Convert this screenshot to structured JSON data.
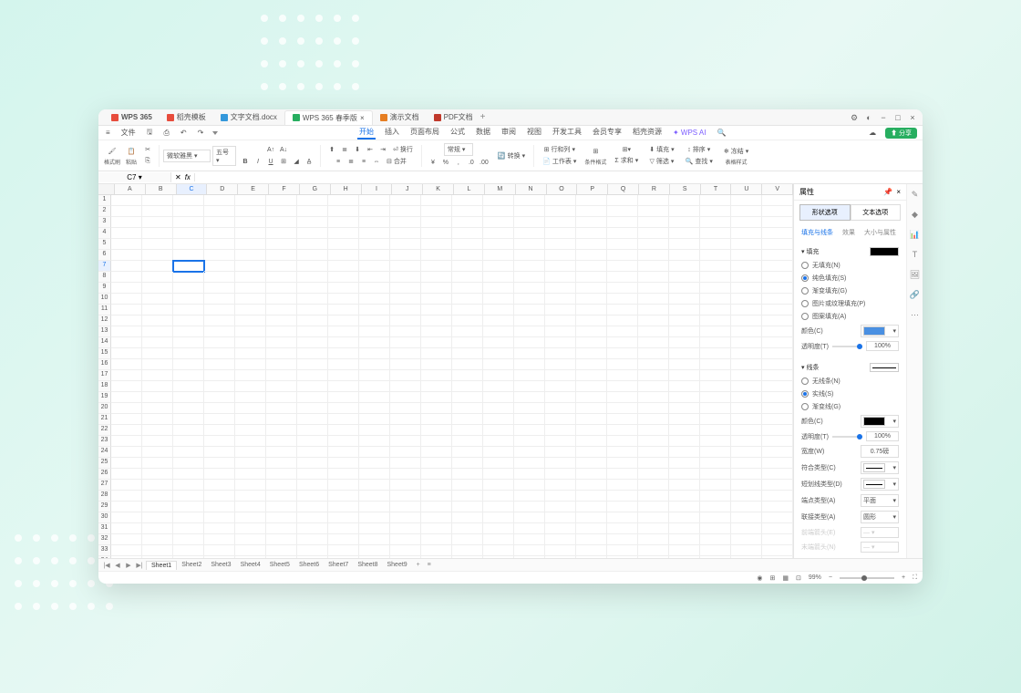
{
  "titlebar": {
    "logo": "WPS 365",
    "tabs": [
      {
        "label": "稻壳模板",
        "icon": "red"
      },
      {
        "label": "文字文档.docx",
        "icon": "blue"
      },
      {
        "label": "WPS 365 春季版",
        "icon": "green",
        "active": true
      },
      {
        "label": "演示文档",
        "icon": "orange"
      },
      {
        "label": "PDF文档",
        "icon": "pdf"
      }
    ]
  },
  "menubar": {
    "file": "文件",
    "items": [
      "开始",
      "插入",
      "页面布局",
      "公式",
      "数据",
      "审阅",
      "视图",
      "开发工具",
      "会员专享",
      "稻壳资源"
    ],
    "active_index": 0,
    "wps_ai": "WPS AI",
    "share": "分享"
  },
  "ribbon": {
    "format_brush": "格式刷",
    "paste": "粘贴",
    "font": "微软雅黑",
    "font_size": "五号",
    "number_format": "常规",
    "wrap_text": "换行",
    "convert": "转换",
    "merge": "合并",
    "row_col": "行和列",
    "worksheet": "工作表",
    "cond_fmt": "条件格式",
    "fill": "填充",
    "sort": "排序",
    "filter": "筛选",
    "freeze": "冻结",
    "find": "查找",
    "sum": "求和",
    "table_style": "表格样式"
  },
  "formula": {
    "cell_ref": "C7"
  },
  "columns": [
    "A",
    "B",
    "C",
    "D",
    "E",
    "F",
    "G",
    "H",
    "I",
    "J",
    "K",
    "L",
    "M",
    "N",
    "O",
    "P",
    "Q",
    "R",
    "S",
    "T",
    "U",
    "V"
  ],
  "row_count": 45,
  "selected_col": 2,
  "selected_row": 7,
  "sheets": [
    "Sheet1",
    "Sheet2",
    "Sheet3",
    "Sheet4",
    "Sheet5",
    "Sheet6",
    "Sheet7",
    "Sheet8",
    "Sheet9"
  ],
  "active_sheet": 0,
  "panel": {
    "title": "属性",
    "main_tabs": [
      "形状选项",
      "文本选项"
    ],
    "active_main_tab": 0,
    "sub_tabs": [
      "填充与线条",
      "效果",
      "大小与属性"
    ],
    "active_sub_tab": 0,
    "fill": {
      "header": "填充",
      "options": [
        "无填充(N)",
        "纯色填充(S)",
        "渐变填充(G)",
        "图片或纹理填充(P)",
        "图案填充(A)"
      ],
      "selected": 1,
      "color_label": "颜色(C)",
      "trans_label": "透明度(T)",
      "trans_value": "100%"
    },
    "line": {
      "header": "线条",
      "options": [
        "无线条(N)",
        "实线(S)",
        "渐变线(G)"
      ],
      "selected": 1,
      "color_label": "颜色(C)",
      "trans_label": "透明度(T)",
      "trans_value": "100%",
      "width_label": "宽度(W)",
      "width_value": "0.75磅",
      "compound_label": "符合类型(C)",
      "dash_label": "短划线类型(D)",
      "cap_label": "端点类型(A)",
      "cap_value": "平面",
      "join_label": "联接类型(A)",
      "join_value": "圆形",
      "arrow_start": "前端箭头(E)",
      "arrow_end": "末端箭头(N)"
    }
  },
  "status": {
    "zoom": "99%"
  }
}
